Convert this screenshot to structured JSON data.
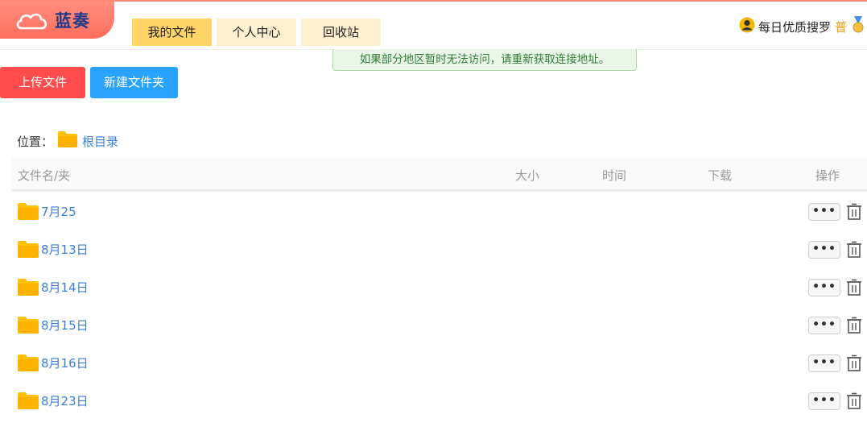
{
  "header": {
    "brand": "蓝奏",
    "nav": [
      {
        "label": "我的文件",
        "active": true
      },
      {
        "label": "个人中心",
        "active": false
      },
      {
        "label": "回收站",
        "active": false
      }
    ],
    "user": {
      "name": "每日优质搜罗",
      "level": "普"
    },
    "notice": "如果部分地区暂时无法访问，请重新获取连接地址。"
  },
  "toolbar": {
    "upload_label": "上传文件",
    "new_folder_label": "新建文件夹"
  },
  "location": {
    "label": "位置：",
    "root": "根目录"
  },
  "table": {
    "columns": [
      "文件名/夹",
      "大小",
      "时间",
      "下载",
      "操作"
    ],
    "rows": [
      {
        "name": "7月25",
        "more": "•••"
      },
      {
        "name": "8月13日",
        "more": "•••"
      },
      {
        "name": "8月14日",
        "more": "•••"
      },
      {
        "name": "8月15日",
        "more": "•••"
      },
      {
        "name": "8月16日",
        "more": "•••"
      },
      {
        "name": "8月23日",
        "more": "•••"
      }
    ]
  },
  "colors": {
    "accent_orange": "#ffd567",
    "upload_red": "#ff4d4d",
    "new_folder_blue": "#2aa3ff",
    "link_blue": "#3a7fd9",
    "folder_yellow": "#ffc107",
    "notice_green": "#2e7d32"
  },
  "icons": {
    "logo": "cloud-icon",
    "user": "user-avatar-icon",
    "medal": "medal-icon",
    "folder": "folder-icon",
    "delete": "trash-icon"
  }
}
